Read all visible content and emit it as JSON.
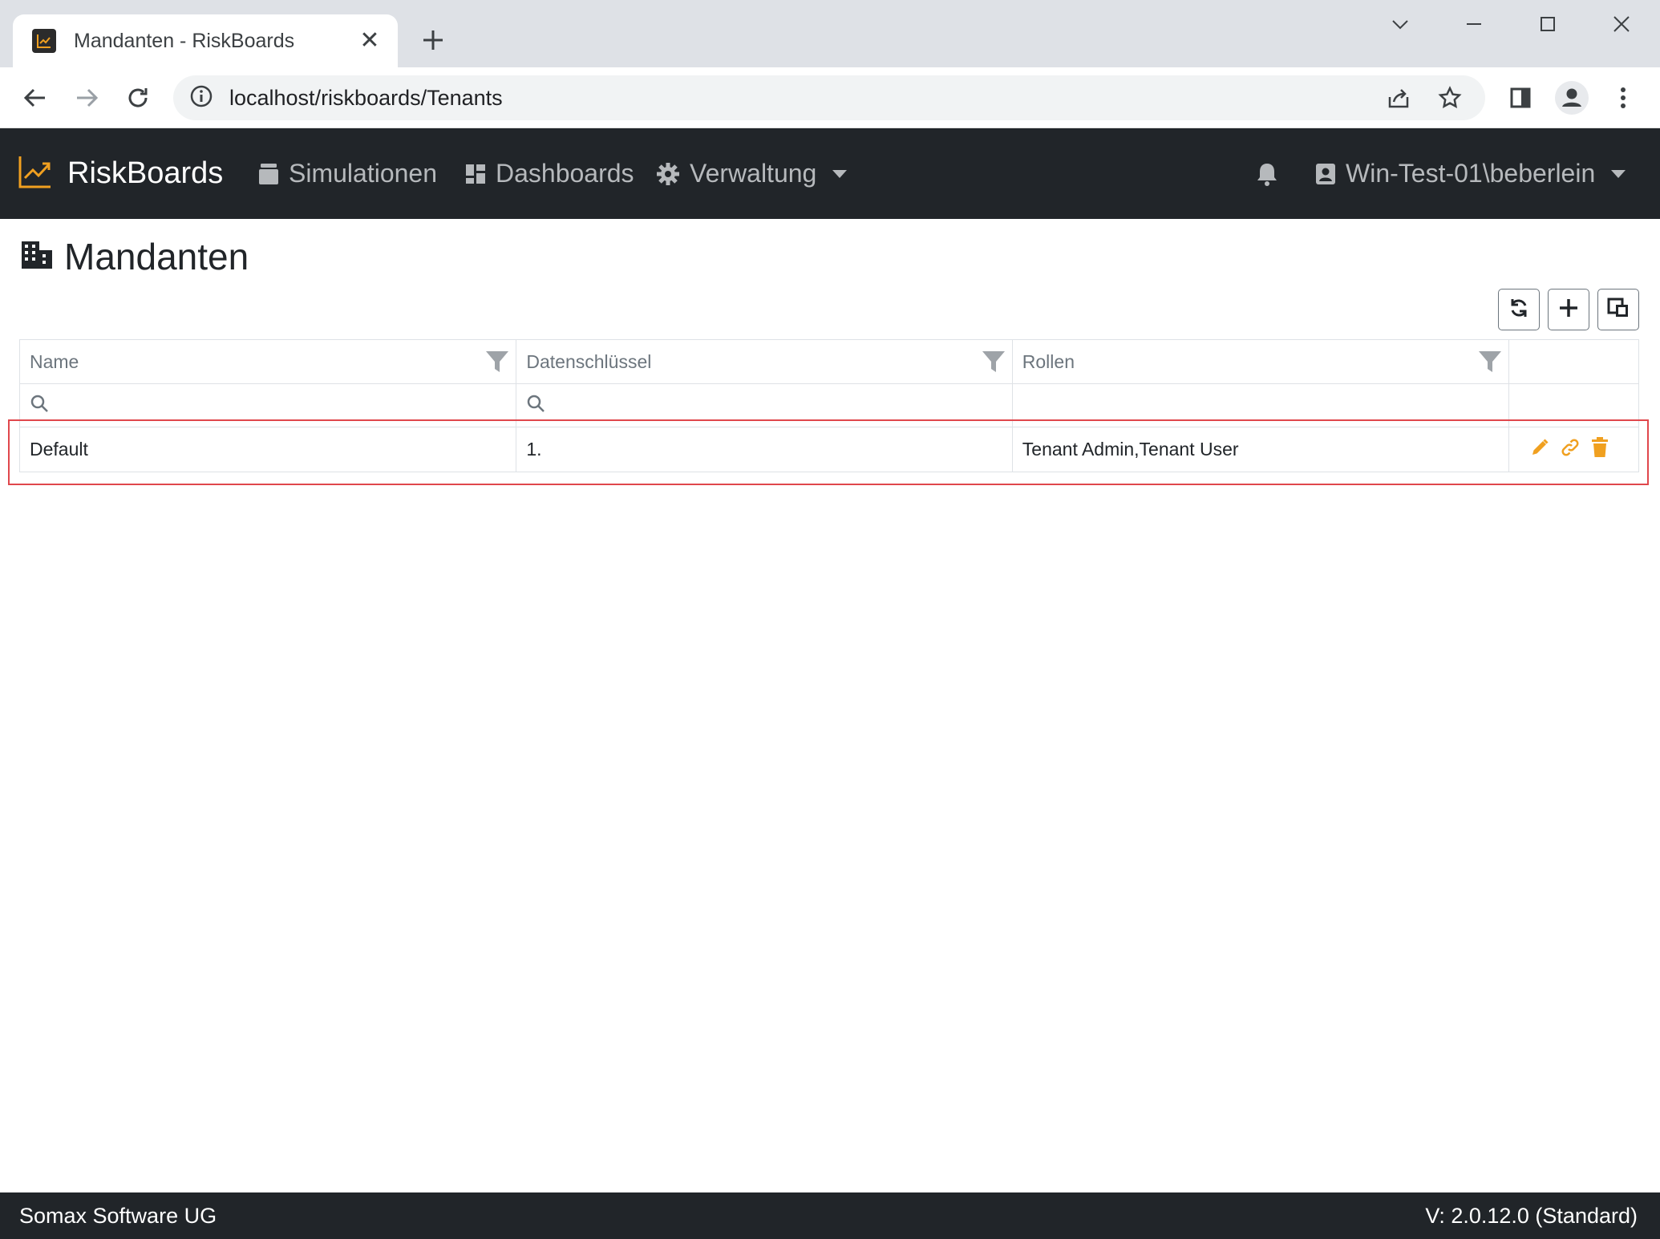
{
  "browser": {
    "tab_title": "Mandanten - RiskBoards",
    "url": "localhost/riskboards/Tenants"
  },
  "navbar": {
    "brand": "RiskBoards",
    "items": [
      {
        "label": "Simulationen",
        "icon": "database-icon"
      },
      {
        "label": "Dashboards",
        "icon": "dashboard-icon"
      },
      {
        "label": "Verwaltung",
        "icon": "gear-icon"
      }
    ],
    "user": "Win-Test-01\\beberlein"
  },
  "page": {
    "title": "Mandanten"
  },
  "grid": {
    "columns": [
      "Name",
      "Datenschlüssel",
      "Rollen"
    ],
    "rows": [
      {
        "name": "Default",
        "key": "1.",
        "roles": "Tenant Admin,Tenant User"
      }
    ]
  },
  "colors": {
    "navbar_bg": "#212529",
    "accent_orange": "#f0a020",
    "highlight_red": "#e0474c"
  },
  "footer": {
    "company": "Somax Software UG",
    "version": "V: 2.0.12.0 (Standard)"
  }
}
